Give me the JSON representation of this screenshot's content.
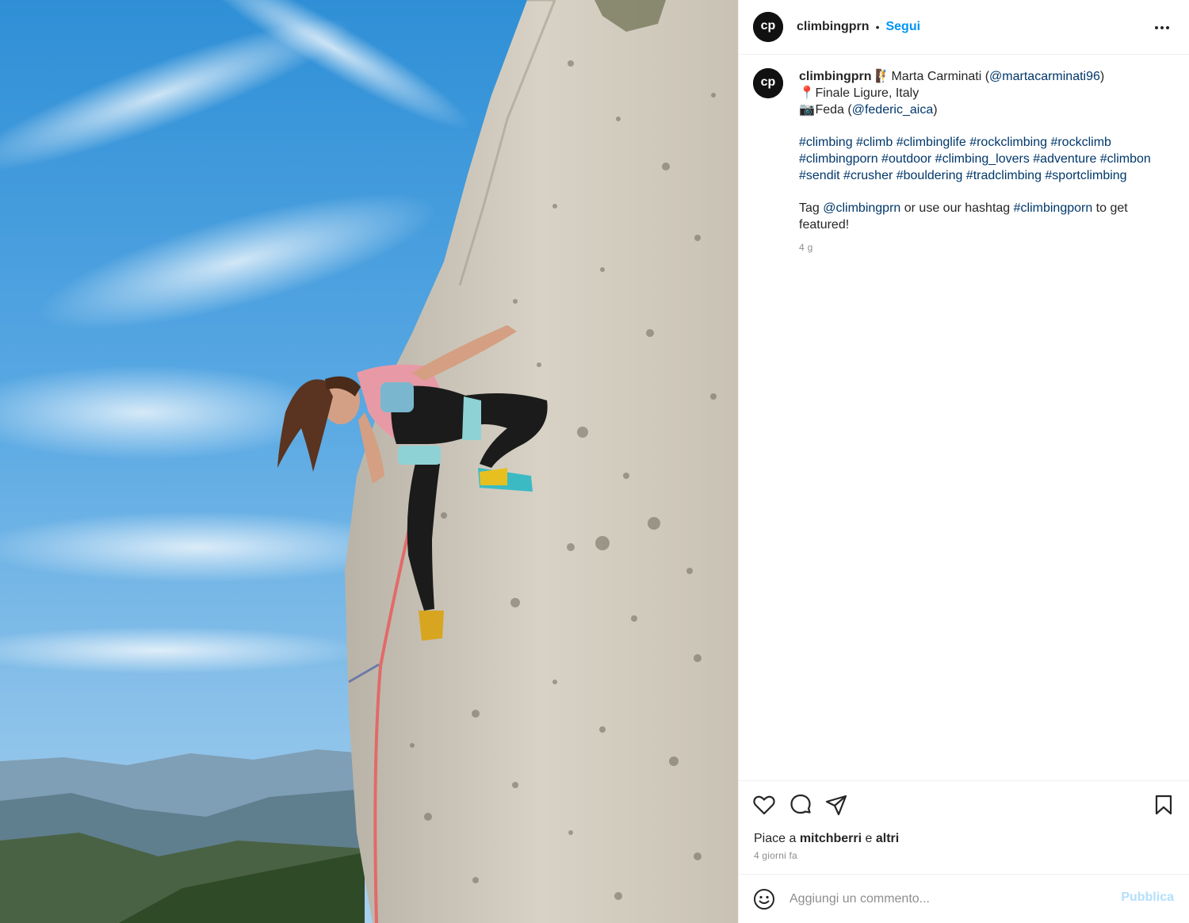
{
  "post": {
    "username": "climbingprn",
    "follow_label": "Segui",
    "separator": "•"
  },
  "caption": {
    "username": "climbingprn",
    "line1_emoji": "🧗",
    "line1_text": "Marta Carminati (",
    "line1_mention": "@martacarminati96",
    "line1_close": ")",
    "line2_emoji": "📍",
    "line2_text": "Finale Ligure, Italy",
    "line3_emoji": "📷",
    "line3_text": "Feda (",
    "line3_mention": "@federic_aica",
    "line3_close": ")",
    "hashtag_lines": [
      "#climbing #climb #climbinglife #rockclimbing #rockclimb",
      "#climbingporn #outdoor #climbing_lovers #adventure #climbon",
      "#sendit #crusher #bouldering #tradclimbing #sportclimbing"
    ],
    "tag_prefix": "Tag ",
    "tag_mention": "@climbingprn",
    "tag_middle": " or use our hashtag ",
    "tag_hashtag": "#climbingporn",
    "tag_suffix": " to get",
    "tag_line2": "featured!",
    "time": "4 g"
  },
  "likes": {
    "prefix": "Piace a ",
    "user": "mitchberri",
    "middle": " e ",
    "others": "altri"
  },
  "posted_ago": "4 giorni fa",
  "comment": {
    "placeholder": "Aggiungi un commento...",
    "publish_label": "Pubblica"
  },
  "icons": {
    "avatar": "climbingprn-logo-icon",
    "more": "more-options-icon",
    "like": "heart-icon",
    "comment": "comment-bubble-icon",
    "share": "paper-plane-icon",
    "save": "bookmark-icon",
    "emoji": "smiley-icon"
  },
  "colors": {
    "link": "#00376b",
    "follow": "#0095f6",
    "publish_disabled": "#b2dffc",
    "muted": "#8e8e8e"
  }
}
